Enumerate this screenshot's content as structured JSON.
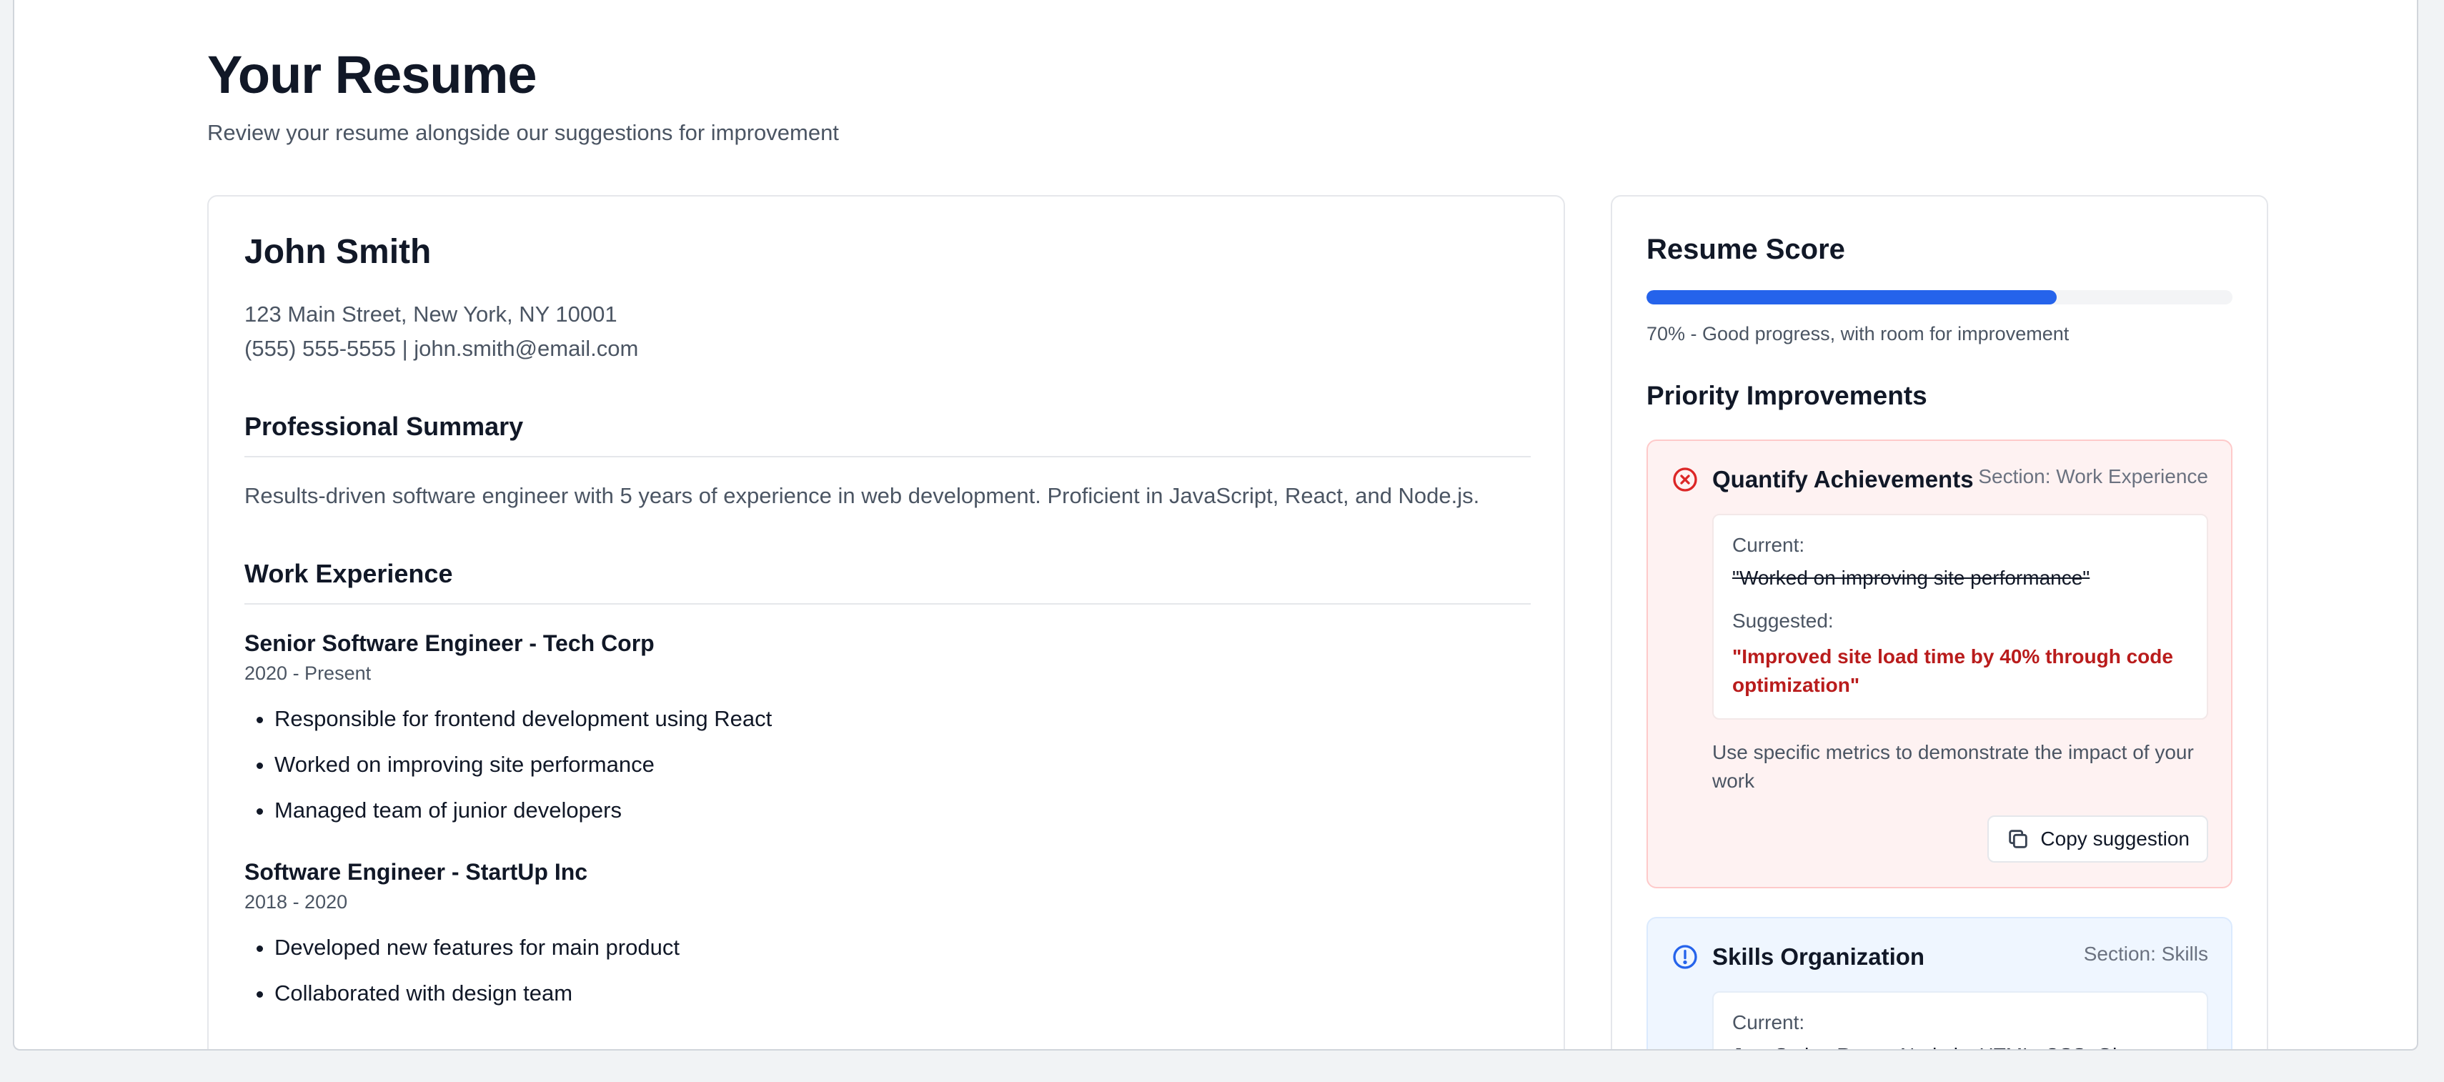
{
  "header": {
    "title": "Your Resume",
    "subtitle": "Review your resume alongside our suggestions for improvement"
  },
  "resume": {
    "name": "John Smith",
    "address": "123 Main Street, New York, NY 10001",
    "contact": "(555) 555-5555 | john.smith@email.com",
    "summary_heading": "Professional Summary",
    "summary": "Results-driven software engineer with 5 years of experience in web development. Proficient in JavaScript, React, and Node.js.",
    "work_heading": "Work Experience",
    "jobs": [
      {
        "title": "Senior Software Engineer - Tech Corp",
        "dates": "2020 - Present",
        "bullets": [
          "Responsible for frontend development using React",
          "Worked on improving site performance",
          "Managed team of junior developers"
        ]
      },
      {
        "title": "Software Engineer - StartUp Inc",
        "dates": "2018 - 2020",
        "bullets": [
          "Developed new features for main product",
          "Collaborated with design team"
        ]
      }
    ]
  },
  "score": {
    "title": "Resume Score",
    "percent": 70,
    "text": "70% - Good progress, with room for improvement",
    "bar_color": "#2563eb"
  },
  "priority": {
    "title": "Priority Improvements",
    "items": [
      {
        "icon": "x-circle-icon",
        "title": "Quantify Achievements",
        "section": "Section: Work Experience",
        "current_label": "Current:",
        "current": "\"Worked on improving site performance\"",
        "suggested_label": "Suggested:",
        "suggested": "\"Improved site load time by 40% through code optimization\"",
        "tip": "Use specific metrics to demonstrate the impact of your work",
        "copy_label": "Copy suggestion"
      },
      {
        "icon": "alert-circle-icon",
        "title": "Skills Organization",
        "section": "Section: Skills",
        "current_label": "Current:",
        "current": "JavaScript, React, Node.js, HTML, CSS, Git"
      }
    ]
  }
}
